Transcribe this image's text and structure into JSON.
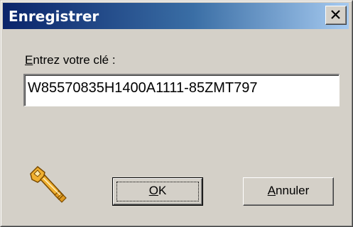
{
  "window": {
    "title": "Enregistrer",
    "close_icon": "close-icon"
  },
  "form": {
    "label_mnemonic": "E",
    "label_rest": "ntrez votre clé :",
    "key_value": "W85570835H1400A1111-85ZMT797"
  },
  "icon": {
    "name": "key-icon",
    "color": "#f0b030"
  },
  "buttons": {
    "ok_mnemonic": "O",
    "ok_rest": "K",
    "cancel_mnemonic": "A",
    "cancel_rest": "nnuler"
  },
  "colors": {
    "titlebar_start": "#0a246a",
    "titlebar_end": "#a6caf0",
    "dialog_face": "#d4d0c8"
  }
}
